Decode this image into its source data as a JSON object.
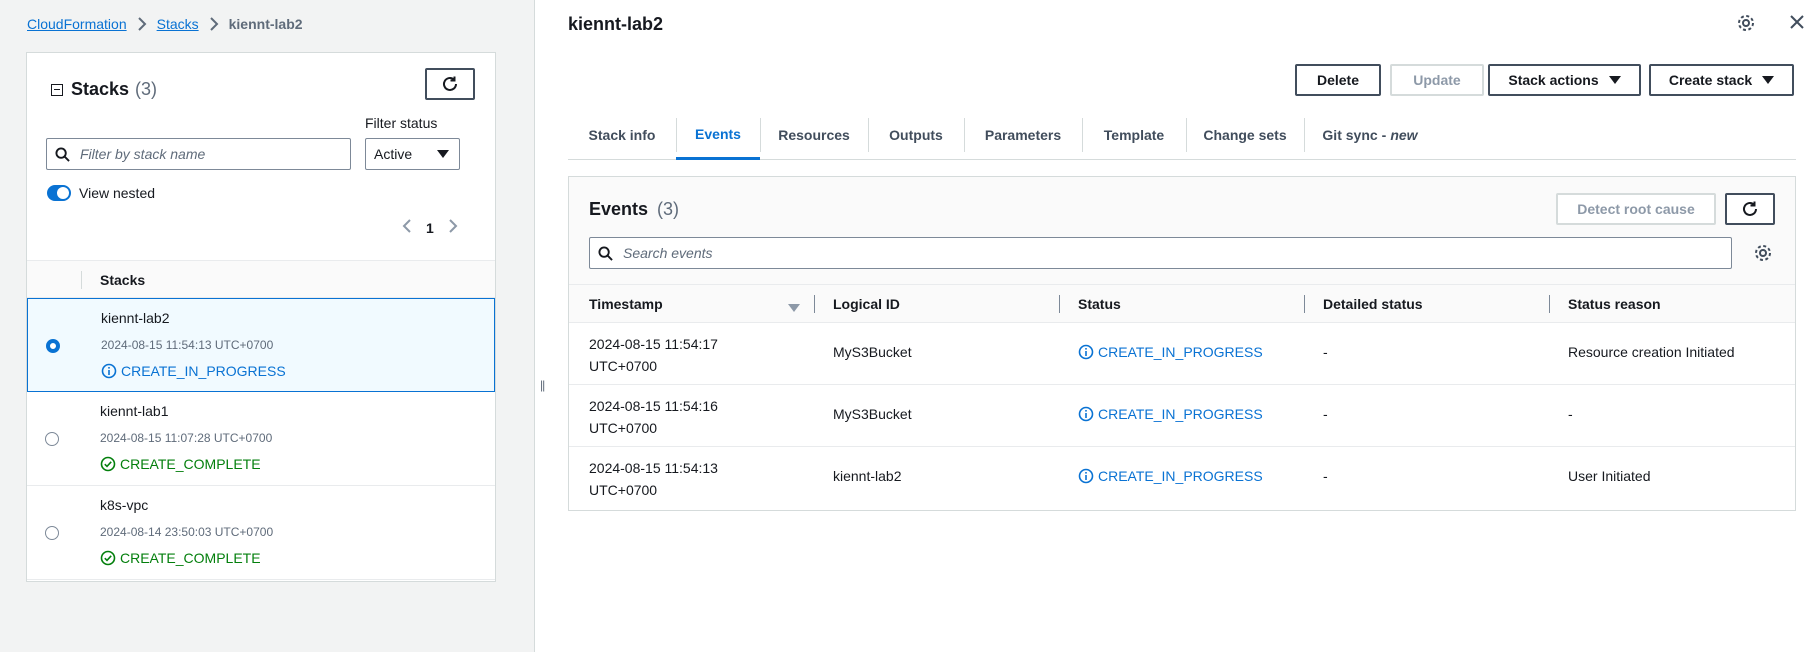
{
  "breadcrumb": {
    "items": [
      "CloudFormation",
      "Stacks"
    ],
    "current": "kiennt-lab2"
  },
  "stacks_panel": {
    "title": "Stacks",
    "count": "(3)",
    "filter_label": "Filter status",
    "search_placeholder": "Filter by stack name",
    "filter_value": "Active",
    "view_nested_label": "View nested",
    "page_number": "1",
    "column_header": "Stacks",
    "rows": [
      {
        "name": "kiennt-lab2",
        "time": "2024-08-15 11:54:13 UTC+0700",
        "status": "CREATE_IN_PROGRESS"
      },
      {
        "name": "kiennt-lab1",
        "time": "2024-08-15 11:07:28 UTC+0700",
        "status": "CREATE_COMPLETE"
      },
      {
        "name": "k8s-vpc",
        "time": "2024-08-14 23:50:03 UTC+0700",
        "status": "CREATE_COMPLETE"
      }
    ]
  },
  "detail": {
    "title": "kiennt-lab2",
    "buttons": {
      "delete": "Delete",
      "update": "Update",
      "stack_actions": "Stack actions",
      "create_stack": "Create stack"
    },
    "tabs": [
      {
        "label": "Stack info"
      },
      {
        "label": "Events"
      },
      {
        "label": "Resources"
      },
      {
        "label": "Outputs"
      },
      {
        "label": "Parameters"
      },
      {
        "label": "Template"
      },
      {
        "label": "Change sets"
      },
      {
        "label": "Git sync",
        "suffix": "new"
      }
    ],
    "events": {
      "title": "Events",
      "count": "(3)",
      "detect_root_cause": "Detect root cause",
      "search_placeholder": "Search events",
      "columns": [
        "Timestamp",
        "Logical ID",
        "Status",
        "Detailed status",
        "Status reason"
      ],
      "rows": [
        {
          "ts_date": "2024-08-15 11:54:17",
          "ts_tz": "UTC+0700",
          "logical_id": "MyS3Bucket",
          "status": "CREATE_IN_PROGRESS",
          "detailed": "-",
          "reason": "Resource creation Initiated"
        },
        {
          "ts_date": "2024-08-15 11:54:16",
          "ts_tz": "UTC+0700",
          "logical_id": "MyS3Bucket",
          "status": "CREATE_IN_PROGRESS",
          "detailed": "-",
          "reason": "-"
        },
        {
          "ts_date": "2024-08-15 11:54:13",
          "ts_tz": "UTC+0700",
          "logical_id": "kiennt-lab2",
          "status": "CREATE_IN_PROGRESS",
          "detailed": "-",
          "reason": "User Initiated"
        }
      ]
    }
  },
  "colors": {
    "link": "#0972d3",
    "success": "#037f0c",
    "border": "#d5dbdb",
    "selected_bg": "#f1faff"
  }
}
